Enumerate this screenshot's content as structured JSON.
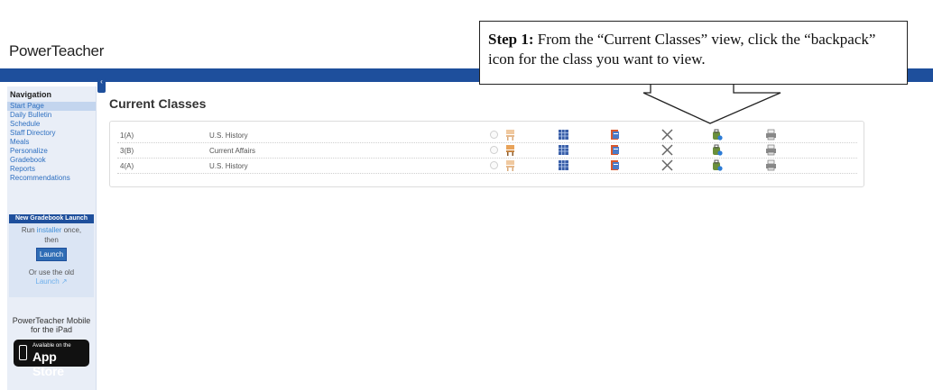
{
  "header": {
    "logo": "PowerTeacher"
  },
  "sidebar": {
    "title": "Navigation",
    "items": [
      {
        "label": "Start Page"
      },
      {
        "label": "Daily Bulletin"
      },
      {
        "label": "Schedule"
      },
      {
        "label": "Staff Directory"
      },
      {
        "label": "Meals"
      },
      {
        "label": "Personalize"
      },
      {
        "label": "Gradebook"
      },
      {
        "label": "Reports"
      },
      {
        "label": "Recommendations"
      }
    ],
    "launch": {
      "heading": "New Gradebook Launch",
      "run_prefix": "Run ",
      "installer_link": "installer",
      "run_suffix": " once,",
      "then": "then",
      "launch_button": "Launch",
      "or_use": "Or use the old",
      "old_launch_link": "Launch"
    },
    "mobile_text": "PowerTeacher Mobile for the iPad",
    "appstore": {
      "small": "Available on the",
      "big": "App Store"
    }
  },
  "main": {
    "title": "Current Classes",
    "rows": [
      {
        "period": "1(A)",
        "course": "U.S. History"
      },
      {
        "period": "3(B)",
        "course": "Current Affairs"
      },
      {
        "period": "4(A)",
        "course": "U.S. History"
      }
    ],
    "row_icons": [
      "radio-icon",
      "seating-chart-icon",
      "gradebook-grid-icon",
      "roster-book-icon",
      "tools-icon",
      "backpack-icon",
      "printer-icon"
    ]
  },
  "callout": {
    "step": "Step 1:",
    "text": " From the “Current Classes” view, click the “backpack” icon for the class you want to view."
  },
  "colors": {
    "brand_blue": "#1e4f9c",
    "link_blue": "#2d6fc0",
    "sidebar_bg": "#e9eef7"
  }
}
